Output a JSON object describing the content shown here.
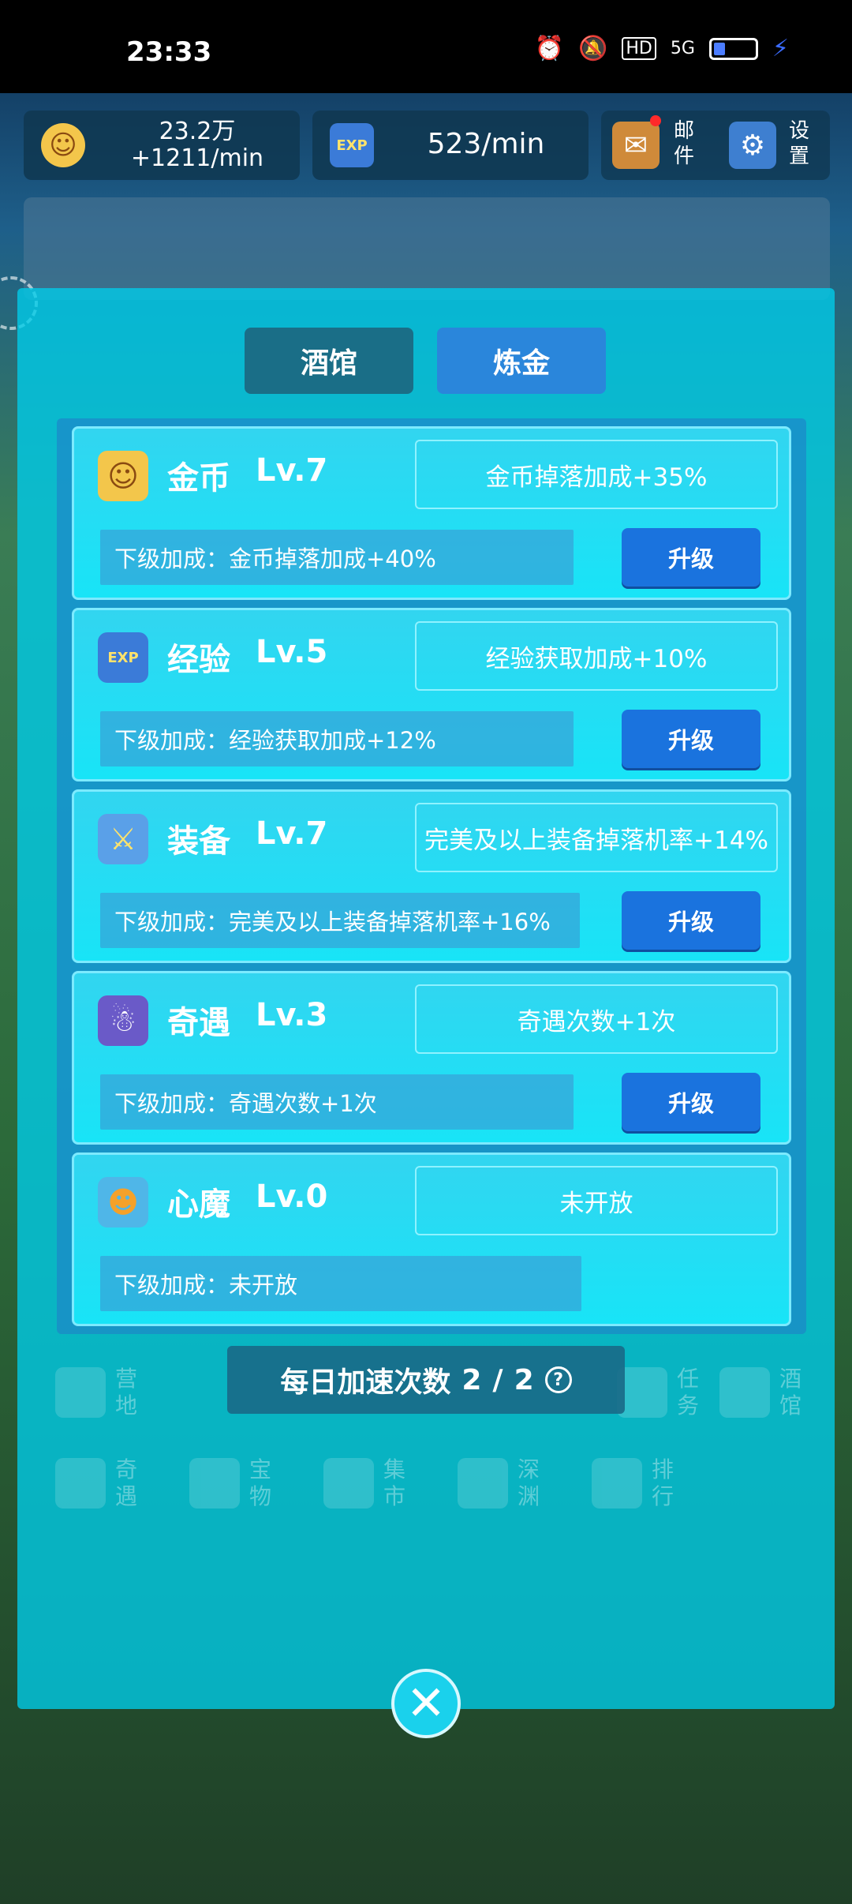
{
  "status_bar": {
    "time": "23:33",
    "network": "5G",
    "hd": "HD"
  },
  "hud": {
    "gold_amount": "23.2万",
    "gold_rate": "+1211/min",
    "exp_rate": "523/min",
    "mail_label": "邮件",
    "settings_label": "设置",
    "exp_icon_text": "EXP"
  },
  "tabs": [
    {
      "label": "酒馆"
    },
    {
      "label": "炼金"
    }
  ],
  "cards": [
    {
      "icon": "gold-coin-icon",
      "name": "金币",
      "level": "Lv.7",
      "current": "金币掉落加成+35%",
      "next": "下级加成：金币掉落加成+40%",
      "button": "升级"
    },
    {
      "icon": "exp-book-icon",
      "name": "经验",
      "level": "Lv.5",
      "current": "经验获取加成+10%",
      "next": "下级加成：经验获取加成+12%",
      "button": "升级"
    },
    {
      "icon": "sword-shield-icon",
      "name": "装备",
      "level": "Lv.7",
      "current": "完美及以上装备掉落机率+14%",
      "next": "下级加成：完美及以上装备掉落机率+16%",
      "button": "升级"
    },
    {
      "icon": "adventure-icon",
      "name": "奇遇",
      "level": "Lv.3",
      "current": "奇遇次数+1次",
      "next": "下级加成：奇遇次数+1次",
      "button": "升级"
    },
    {
      "icon": "heart-demon-icon",
      "name": "心魔",
      "level": "Lv.0",
      "current": "未开放",
      "next": "下级加成：未开放"
    }
  ],
  "speedup": {
    "label": "每日加速次数",
    "current": "2",
    "sep": "/",
    "max": "2",
    "help": "?"
  },
  "bg_menu": [
    "营地",
    "任务",
    "酒馆",
    "奇遇",
    "宝物",
    "集市",
    "深渊",
    "排行"
  ],
  "close": "✕"
}
